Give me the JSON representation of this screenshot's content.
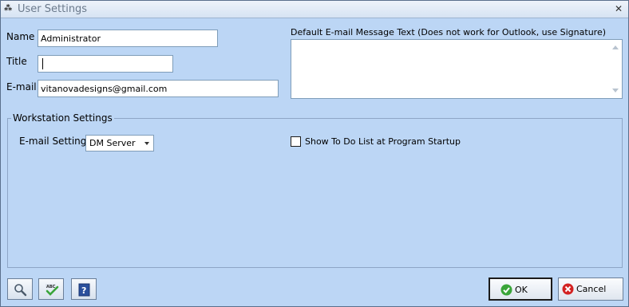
{
  "window": {
    "title": "User Settings",
    "app_icon": "⁂"
  },
  "form": {
    "name_label": "Name",
    "name_value": "Administrator",
    "title_label": "Title",
    "title_value": "",
    "email_label": "E-mail",
    "email_value": "vitanovadesigns@gmail.com",
    "message_label": "Default E-mail Message Text (Does not work for Outlook, use Signature)",
    "message_value": ""
  },
  "workstation": {
    "group_title": "Workstation Settings",
    "email_setting_label": "E-mail Setting",
    "email_setting_value": "DM Server",
    "todo_checkbox_label": "Show To Do List at Program Startup",
    "todo_checked": false
  },
  "footer": {
    "ok_label": "OK",
    "cancel_label": "Cancel"
  },
  "colors": {
    "background": "#bcd6f5",
    "ok_icon": "#3aa53a",
    "cancel_icon": "#d32222",
    "help_icon": "#2a4f9c"
  }
}
